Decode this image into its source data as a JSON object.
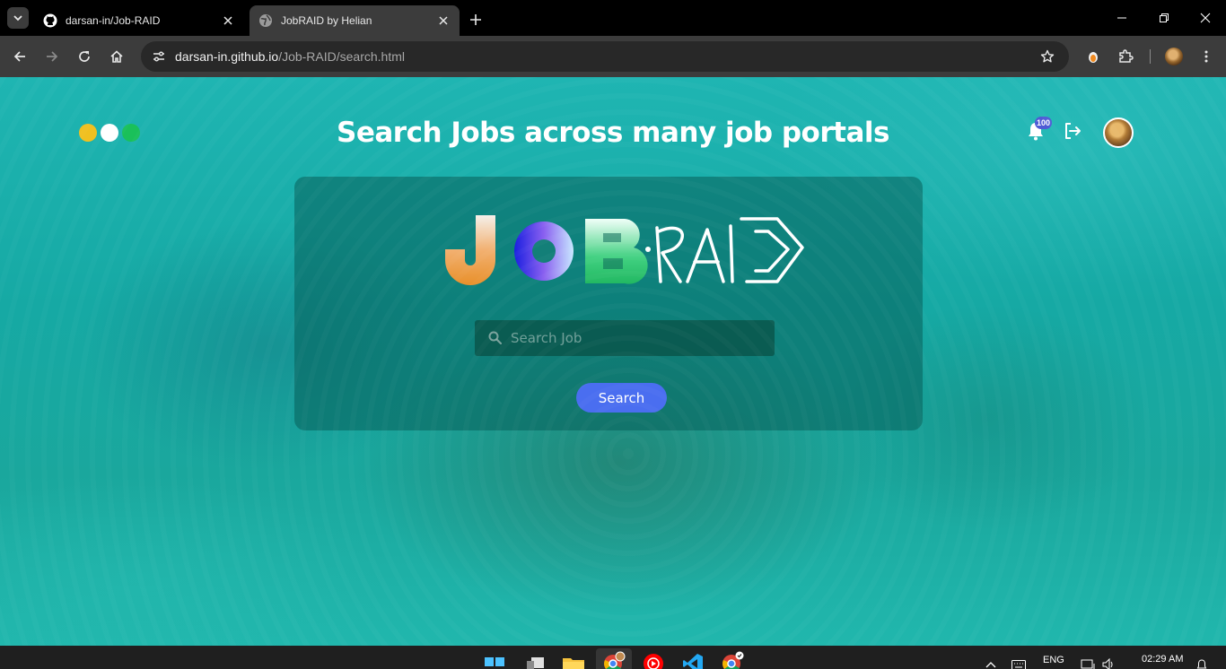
{
  "browser": {
    "tabs": [
      {
        "title": "darsan-in/Job-RAID",
        "icon": "github-icon",
        "active": false
      },
      {
        "title": "JobRAID by Helian",
        "icon": "globe-icon",
        "active": true
      }
    ],
    "url_host": "darsan-in.github.io",
    "url_path": "/Job-RAID/search.html"
  },
  "page": {
    "heading": "Search Jobs across many job portals",
    "notification_count": "100",
    "dots": [
      "#f0c020",
      "#ffffff",
      "#1ac05a"
    ],
    "logo": {
      "j": "J",
      "o": "O",
      "b": "B",
      "raid": "RAID"
    },
    "search": {
      "placeholder": "Search Job",
      "value": "",
      "button_label": "Search"
    }
  },
  "taskbar": {
    "language": "ENG",
    "time": "02:29 AM",
    "apps": [
      "windows-start-icon",
      "task-view-icon",
      "file-explorer-icon",
      "chrome-profile-icon",
      "youtube-music-icon",
      "vscode-icon",
      "chrome-icon"
    ]
  }
}
